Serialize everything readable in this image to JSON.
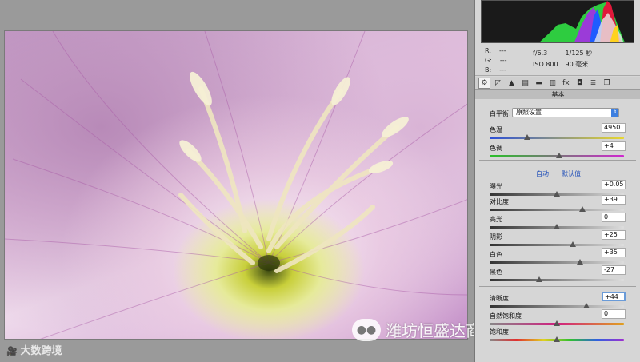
{
  "watermarks": {
    "bottom_left": "大数跨境",
    "bottom_right": "潍坊恒盛达商贸有限公司"
  },
  "info": {
    "r_label": "R:",
    "r_value": "---",
    "g_label": "G:",
    "g_value": "---",
    "b_label": "B:",
    "b_value": "---",
    "aperture": "f/6.3",
    "shutter": "1/125 秒",
    "iso": "ISO 800",
    "focal": "90 毫米"
  },
  "tabs": [
    {
      "icon": "aperture-icon",
      "glyph": "⚙"
    },
    {
      "icon": "tone-curve-icon",
      "glyph": "◸"
    },
    {
      "icon": "detail-icon",
      "glyph": "▲"
    },
    {
      "icon": "hsl-icon",
      "glyph": "▤"
    },
    {
      "icon": "split-tone-icon",
      "glyph": "▬"
    },
    {
      "icon": "lens-icon",
      "glyph": "▥"
    },
    {
      "icon": "fx-icon",
      "glyph": "fx"
    },
    {
      "icon": "camera-calibration-icon",
      "glyph": "◘"
    },
    {
      "icon": "presets-icon",
      "glyph": "≣"
    },
    {
      "icon": "snapshots-icon",
      "glyph": "❐"
    }
  ],
  "section_title": "基本",
  "white_balance": {
    "label": "白平衡:",
    "value": "原照设置"
  },
  "auto_label": "自动",
  "default_label": "默认值",
  "sliders": [
    {
      "key": "temp",
      "label": "色温",
      "value": "4950",
      "pos": 0.28,
      "track": "temp"
    },
    {
      "key": "tint",
      "label": "色调",
      "value": "+4",
      "pos": 0.52,
      "track": "tint"
    },
    {
      "key": "exposure",
      "label": "曝光",
      "value": "+0.05",
      "pos": 0.5,
      "track": "gray"
    },
    {
      "key": "contrast",
      "label": "对比度",
      "value": "+39",
      "pos": 0.69,
      "track": "gray"
    },
    {
      "key": "highlights",
      "label": "高光",
      "value": "0",
      "pos": 0.5,
      "track": "gray"
    },
    {
      "key": "shadows",
      "label": "阴影",
      "value": "+25",
      "pos": 0.62,
      "track": "gray"
    },
    {
      "key": "whites",
      "label": "白色",
      "value": "+35",
      "pos": 0.67,
      "track": "gray"
    },
    {
      "key": "blacks",
      "label": "黑色",
      "value": "-27",
      "pos": 0.37,
      "track": "gray"
    },
    {
      "key": "clarity",
      "label": "清晰度",
      "value": "+44",
      "pos": 0.72,
      "track": "gray",
      "focus": true
    },
    {
      "key": "vibrance",
      "label": "自然饱和度",
      "value": "0",
      "pos": 0.5,
      "track": "vib"
    },
    {
      "key": "saturation",
      "label": "饱和度",
      "value": "",
      "pos": 0.5,
      "track": "sat"
    }
  ]
}
